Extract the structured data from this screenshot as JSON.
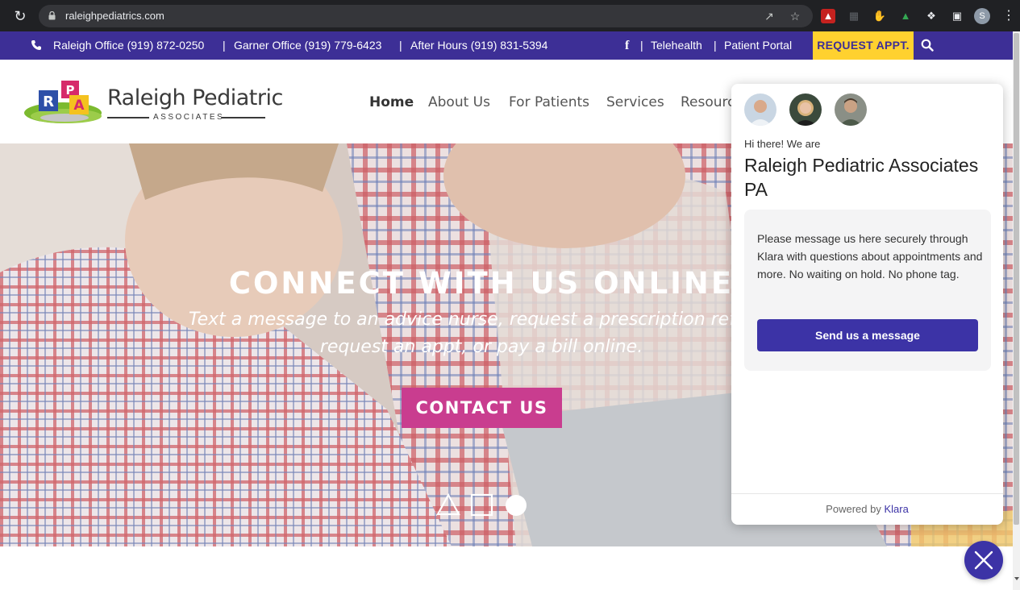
{
  "browser": {
    "url": "raleighpediatrics.com",
    "profile_initial": "S"
  },
  "topbar": {
    "raleigh": "Raleigh Office (919) 872-0250",
    "garner": "Garner Office (919) 779-6423",
    "after_hours": "After Hours (919) 831-5394",
    "sep": "|",
    "telehealth": "Telehealth",
    "portal": "Patient Portal",
    "request": "REQUEST APPT.",
    "bg_color": "#3d2f96",
    "request_color": "#ffd12f"
  },
  "logo": {
    "name": "Raleigh Pediatric",
    "sub": "ASSOCIATES",
    "blocks": [
      "R",
      "P",
      "A"
    ]
  },
  "nav": [
    "Home",
    "About Us",
    "For Patients",
    "Services",
    "Resourc"
  ],
  "hero": {
    "title": "CONNECT WITH US ONLINE",
    "subtitle": "Text a message to an advice nurse, request a prescription refill or request an appt, or pay a bill online.",
    "button": "CONTACT US",
    "button_color": "#c93d8f"
  },
  "chat": {
    "greeting": "Hi there! We are",
    "title": "Raleigh Pediatric Associates PA",
    "message": "Please message us here securely through Klara with questions about appointments and more. No waiting on hold. No phone tag.",
    "send": "Send us a message",
    "powered": "Powered by",
    "brand": "Klara",
    "accent": "#3c33a6"
  }
}
